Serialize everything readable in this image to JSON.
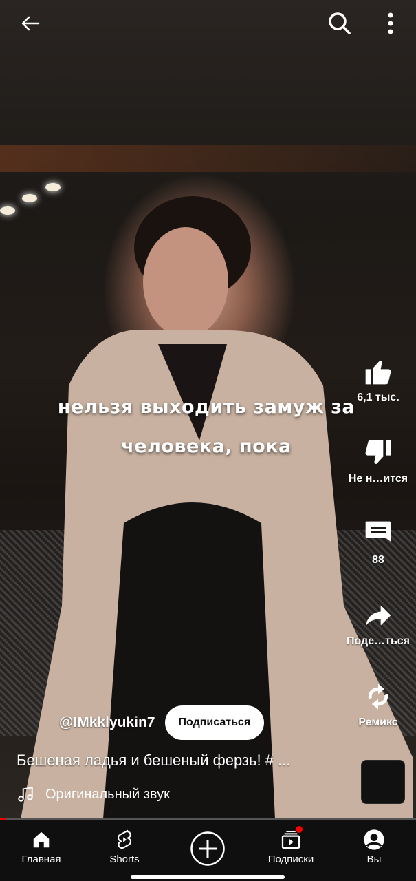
{
  "top_bar": {
    "back_icon": "arrow-left-icon",
    "search_icon": "search-icon",
    "more_icon": "more-vert-icon"
  },
  "video": {
    "subtitle_line1": "нельзя выходить замуж за",
    "subtitle_line2": "человека, пока"
  },
  "actions": {
    "like_count": "6,1 тыс.",
    "dislike_label": "Не н…ится",
    "comments_count": "88",
    "share_label": "Поде…ться",
    "remix_label": "Ремикс"
  },
  "channel": {
    "name": "@IMkklyukin7",
    "subscribe_label": "Подписаться"
  },
  "video_title": "Бешеная ладья и бешеный ферзь! # ...",
  "sound": {
    "label": "Оригинальный звук"
  },
  "progress": {
    "fraction": 0.015
  },
  "bottom_nav": {
    "items": [
      {
        "label": "Главная",
        "icon": "home-icon"
      },
      {
        "label": "Shorts",
        "icon": "shorts-icon"
      },
      {
        "label": "",
        "icon": "create-icon"
      },
      {
        "label": "Подписки",
        "icon": "subscriptions-icon"
      },
      {
        "label": "Вы",
        "icon": "profile-icon"
      }
    ]
  },
  "colors": {
    "accent": "#ff0000",
    "nav_bg": "#0f0f0f",
    "text": "#ffffff"
  }
}
